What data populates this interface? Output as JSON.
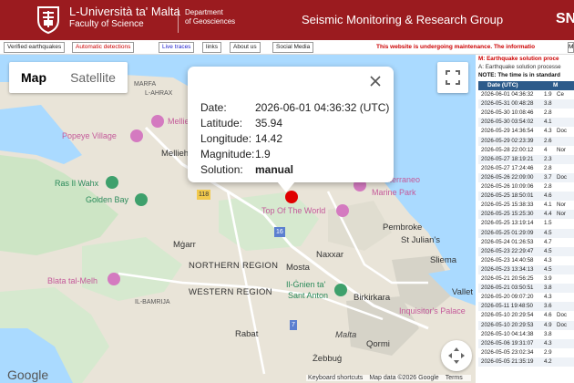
{
  "header": {
    "university_name": "L-Università ta' Malta",
    "faculty": "Faculty of Science",
    "department_line1": "Department",
    "department_line2": "of Geosciences",
    "group_title": "Seismic Monitoring & Research Group",
    "brand_fragment": "SN",
    "brand_color": "#9b1b1f"
  },
  "nav": {
    "items": [
      {
        "label": "Verified earthquakes",
        "color": "normal"
      },
      {
        "label": "Automatic detections",
        "color": "red"
      },
      {
        "label": "Live traces",
        "color": "blue"
      },
      {
        "label": "links",
        "color": "normal"
      },
      {
        "label": "About us",
        "color": "normal"
      },
      {
        "label": "Social Media",
        "color": "normal"
      }
    ],
    "marquee": "This website is undergoing maintenance. The informatio",
    "trailing_button": "M"
  },
  "map": {
    "map_type_map": "Map",
    "map_type_satellite": "Satellite",
    "google_logo": "Google",
    "attribution": [
      "Keyboard shortcuts",
      "Map data ©2026 Google",
      "Terms"
    ],
    "labels": {
      "marfa": "MARFA",
      "lahrax": "L-AHRAX",
      "mellieha_poi": "Mellie",
      "popeye": "Popeye Village",
      "mellieha": "Mellieh",
      "ras_il_wahx": "Ras Il Wahx",
      "golden_bay": "Golden Bay",
      "route_118": "118",
      "top_of_the_world": "Top Of The World",
      "mediterraneo1": "Mediterraneo",
      "mediterraneo2": "Marine Park",
      "pembroke": "Pembroke",
      "st_julians": "St Julian's",
      "mgarr": "Mġarr",
      "naxxar": "Naxxar",
      "northern_region": "NORTHERN REGION",
      "mosta": "Mosta",
      "sliema": "Sliema",
      "blata": "Blata tal-Melh",
      "western_region": "WESTERN REGION",
      "il_gnien1": "Il-Ġnien ta'",
      "il_gnien2": "Sant Anton",
      "birkirkara": "Birkirkara",
      "valletta": "Vallet",
      "il_bamrija": "IL-BAMRIJA",
      "inquisitors": "Inquisitor's Palace",
      "rabat": "Rabat",
      "malta": "Malta",
      "qormi": "Qormi",
      "zebbug": "Żebbuġ",
      "route_16": "16",
      "route_7": "7"
    }
  },
  "infowindow": {
    "date_label": "Date:",
    "date_value": "2026-06-01 04:36:32 (UTC)",
    "lat_label": "Latitude:",
    "lat_value": "35.94",
    "lon_label": "Longitude:",
    "lon_value": "14.42",
    "mag_label": "Magnitude:",
    "mag_value": "1.9",
    "sol_label": "Solution:",
    "sol_value": "manual",
    "epicenter_color": "#e00000"
  },
  "panel": {
    "note_red": "M: Earthquake solution proce",
    "note_a": "A: Earthquake solution processe",
    "note_time": "NOTE: The time is in standard",
    "col_date": "Date (UTC)",
    "col_mag": "M",
    "rows": [
      {
        "date": "2026-06-01 04:36:32",
        "mag": "1.9",
        "suffix": "Ce"
      },
      {
        "date": "2026-05-31 00:48:28",
        "mag": "3.8",
        "suffix": ""
      },
      {
        "date": "2026-05-30 10:08:46",
        "mag": "2.8",
        "suffix": ""
      },
      {
        "date": "2026-05-30 03:54:02",
        "mag": "4.1",
        "suffix": ""
      },
      {
        "date": "2026-05-29 14:36:54",
        "mag": "4.3",
        "suffix": "Doc"
      },
      {
        "date": "2026-05-29 02:23:39",
        "mag": "2.6",
        "suffix": ""
      },
      {
        "date": "2026-05-28 22:00:12",
        "mag": "4",
        "suffix": "Nor"
      },
      {
        "date": "2026-05-27 18:19:21",
        "mag": "2.3",
        "suffix": ""
      },
      {
        "date": "2026-05-27 17:24:46",
        "mag": "2.8",
        "suffix": ""
      },
      {
        "date": "2026-05-26 22:09:00",
        "mag": "3.7",
        "suffix": "Doc"
      },
      {
        "date": "2026-05-26 10:09:06",
        "mag": "2.8",
        "suffix": ""
      },
      {
        "date": "2026-05-25 18:50:01",
        "mag": "4.6",
        "suffix": ""
      },
      {
        "date": "2026-05-25 15:38:33",
        "mag": "4.1",
        "suffix": "Nor"
      },
      {
        "date": "2026-05-25 15:25:30",
        "mag": "4.4",
        "suffix": "Nor"
      },
      {
        "date": "2026-05-25 13:19:14",
        "mag": "1.5",
        "suffix": ""
      },
      {
        "date": "2026-05-25 01:29:09",
        "mag": "4.5",
        "suffix": ""
      },
      {
        "date": "2026-05-24 01:26:53",
        "mag": "4.7",
        "suffix": ""
      },
      {
        "date": "2026-05-23 22:29:47",
        "mag": "4.5",
        "suffix": ""
      },
      {
        "date": "2026-05-23 14:40:58",
        "mag": "4.3",
        "suffix": ""
      },
      {
        "date": "2026-05-23 13:34:13",
        "mag": "4.5",
        "suffix": ""
      },
      {
        "date": "2026-05-21 20:56:25",
        "mag": "3.9",
        "suffix": ""
      },
      {
        "date": "2026-05-21 03:50:51",
        "mag": "3.8",
        "suffix": ""
      },
      {
        "date": "2026-05-20 09:07:20",
        "mag": "4.3",
        "suffix": ""
      },
      {
        "date": "2026-05-11 19:48:50",
        "mag": "3.6",
        "suffix": ""
      },
      {
        "date": "2026-05-10 20:29:54",
        "mag": "4.6",
        "suffix": "Doc"
      },
      {
        "date": "2026-05-10 20:29:53",
        "mag": "4.9",
        "suffix": "Doc"
      },
      {
        "date": "2026-05-10 04:14:38",
        "mag": "3.8",
        "suffix": ""
      },
      {
        "date": "2026-05-06 19:31:07",
        "mag": "4.3",
        "suffix": ""
      },
      {
        "date": "2026-05-05 23:02:34",
        "mag": "2.9",
        "suffix": ""
      },
      {
        "date": "2026-05-05 21:35:19",
        "mag": "4.2",
        "suffix": ""
      }
    ]
  }
}
